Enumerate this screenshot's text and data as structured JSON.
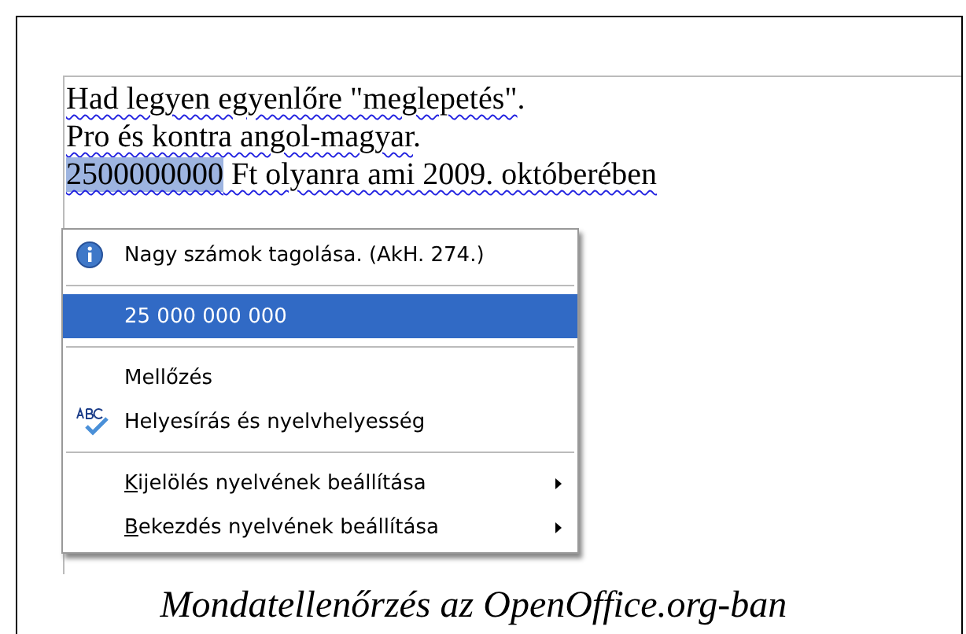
{
  "document": {
    "lines": [
      [
        {
          "text": "Had legyen egyenlőre \"meglepetés\"",
          "marked": true,
          "selected": false
        },
        {
          "text": ".",
          "marked": false,
          "selected": false
        }
      ],
      [
        {
          "text": "Pro és kontra angol-magyar",
          "marked": true,
          "selected": false
        },
        {
          "text": ".",
          "marked": false,
          "selected": false
        }
      ],
      [
        {
          "text": "2500000000",
          "marked": true,
          "selected": true
        },
        {
          "text": " Ft olyanra ami 2009. októberében",
          "marked": true,
          "selected": false
        }
      ]
    ]
  },
  "context_menu": {
    "items": [
      {
        "kind": "info",
        "label": "Nagy számok tagolása. (AkH. 274.)"
      },
      {
        "kind": "separator"
      },
      {
        "kind": "suggestion",
        "label": "25 000 000 000",
        "selected": true
      },
      {
        "kind": "separator"
      },
      {
        "kind": "plain",
        "label": "Mellőzés"
      },
      {
        "kind": "spelling",
        "label": "Helyesírás és nyelvhelyesség"
      },
      {
        "kind": "separator"
      },
      {
        "kind": "submenu",
        "accel": "K",
        "rest": "ijelölés nyelvének beállítása"
      },
      {
        "kind": "submenu",
        "accel": "B",
        "rest": "ekezdés nyelvének beállítása"
      }
    ]
  },
  "caption": "Mondatellenőrzés az OpenOffice.org-ban"
}
